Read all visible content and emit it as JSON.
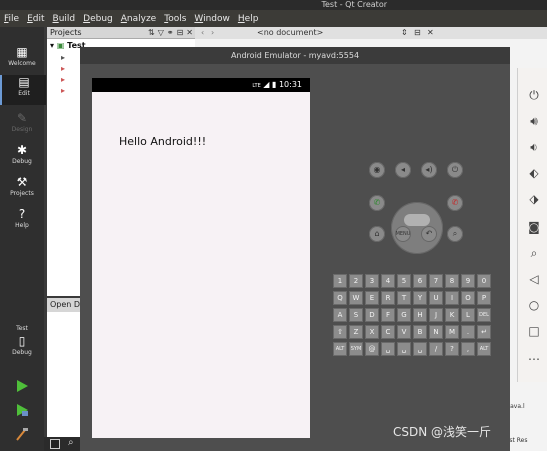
{
  "qt": {
    "title": "Test - Qt Creator",
    "menu": [
      "File",
      "Edit",
      "Build",
      "Debug",
      "Analyze",
      "Tools",
      "Window",
      "Help"
    ],
    "modes": [
      "Welcome",
      "Edit",
      "Design",
      "Debug",
      "Projects",
      "Help"
    ],
    "projects_label": "Projects",
    "project_name": "Test",
    "open_docs_label": "Open D",
    "doc_selector": "<no document>",
    "target_project": "Test",
    "target_mode": "Debug"
  },
  "emulator": {
    "title": "Android Emulator - myavd:5554",
    "time": "10:31",
    "network": "LTE",
    "app_text": "Hello Android!!!",
    "keyboard_rows": [
      [
        "1",
        "2",
        "3",
        "4",
        "5",
        "6",
        "7",
        "8",
        "9",
        "0"
      ],
      [
        "Q",
        "W",
        "E",
        "R",
        "T",
        "Y",
        "U",
        "I",
        "O",
        "P"
      ],
      [
        "A",
        "S",
        "D",
        "F",
        "G",
        "H",
        "J",
        "K",
        "L",
        "DEL"
      ],
      [
        "⇧",
        "Z",
        "X",
        "C",
        "V",
        "B",
        "N",
        "M",
        ".",
        "↵"
      ],
      [
        "ALT",
        "SYM",
        "@",
        "␣",
        "␣",
        "␣",
        "/",
        "?",
        ",",
        "ALT"
      ]
    ]
  },
  "right": {
    "snippet1": "s(java.l",
    "snippet2": "Test Res"
  },
  "watermark": "CSDN @浅笑一斤"
}
